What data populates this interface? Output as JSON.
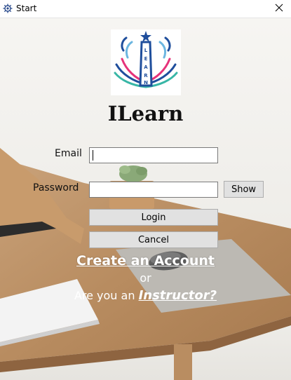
{
  "window": {
    "title": "Start"
  },
  "app": {
    "name": "ILearn",
    "logo_text": "LEARN"
  },
  "form": {
    "email_label": "Email",
    "email_value": "",
    "password_label": "Password",
    "password_value": "",
    "show_label": "Show",
    "login_label": "Login",
    "cancel_label": "Cancel"
  },
  "footer": {
    "create_account": "Create an Account",
    "or": "or",
    "instructor_prefix": "Are you an ",
    "instructor_link": "Instructor?"
  },
  "icons": {
    "app": "gear-icon",
    "close": "close-icon"
  },
  "colors": {
    "link_text": "#ffffff",
    "button_bg": "#e1e1e1",
    "logo_blue": "#1f4e9c",
    "logo_pink": "#e6337a",
    "logo_teal": "#38b6a6"
  }
}
